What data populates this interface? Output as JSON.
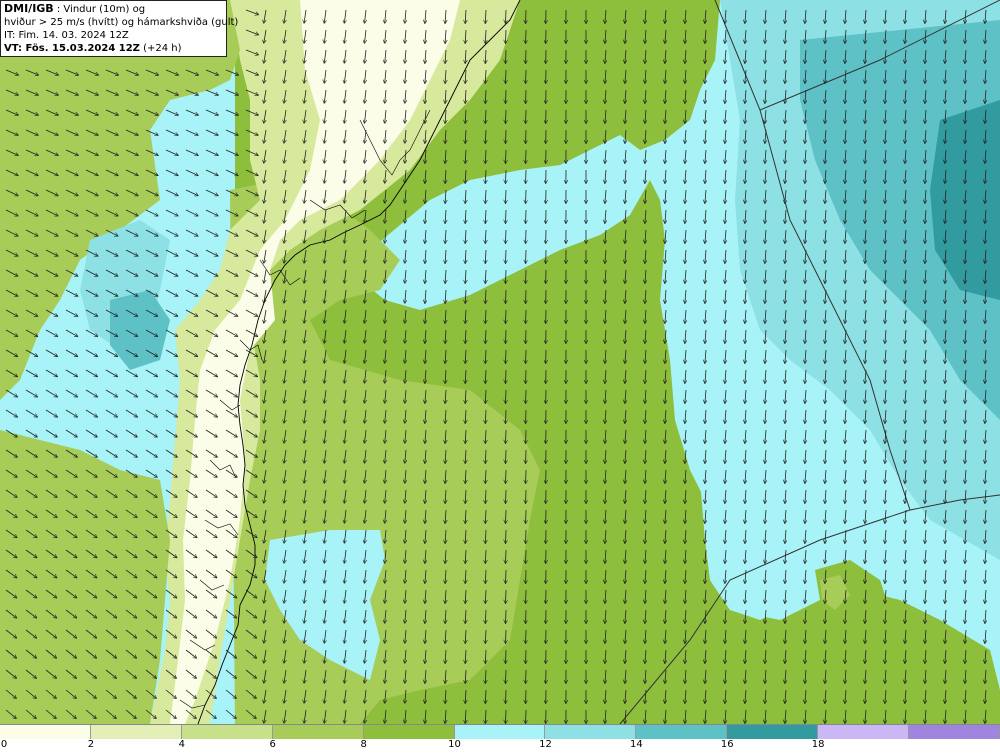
{
  "header": {
    "line1_bold": "DMI/IGB",
    "line1_rest": " : Vindur (10m) og",
    "line2": "hviður > 25 m/s (hvítt) og hámarkshviða (gult)",
    "line3": "IT: Fim. 14. 03. 2024 12Z",
    "line4_bold": "VT: Fös. 15.03.2024 12Z",
    "line4_rest": " (+24 h)"
  },
  "legend": {
    "ticks": [
      "0",
      "2",
      "4",
      "6",
      "8",
      "10",
      "12",
      "14",
      "16",
      "18"
    ],
    "colors": [
      "#fbfde8",
      "#e3efb4",
      "#c7e08a",
      "#a7cc58",
      "#8dbe3c",
      "#a8f3f7",
      "#8de0e3",
      "#5dc1c6",
      "#319b9f",
      "#cbb6f6",
      "#9f85e0"
    ]
  },
  "map": {
    "colors": {
      "land_light": "#fbfde8",
      "land_mid": "#d7e99d",
      "green": "#8dbe3c",
      "green_light": "#a7cc58",
      "cyan": "#a8f3f7",
      "cyan_mid": "#8de0e3",
      "teal": "#5dc1c6",
      "teal_dark": "#319b9f",
      "coast": "#000000"
    },
    "wind_arrow_icon": "wind-arrow-icon"
  }
}
